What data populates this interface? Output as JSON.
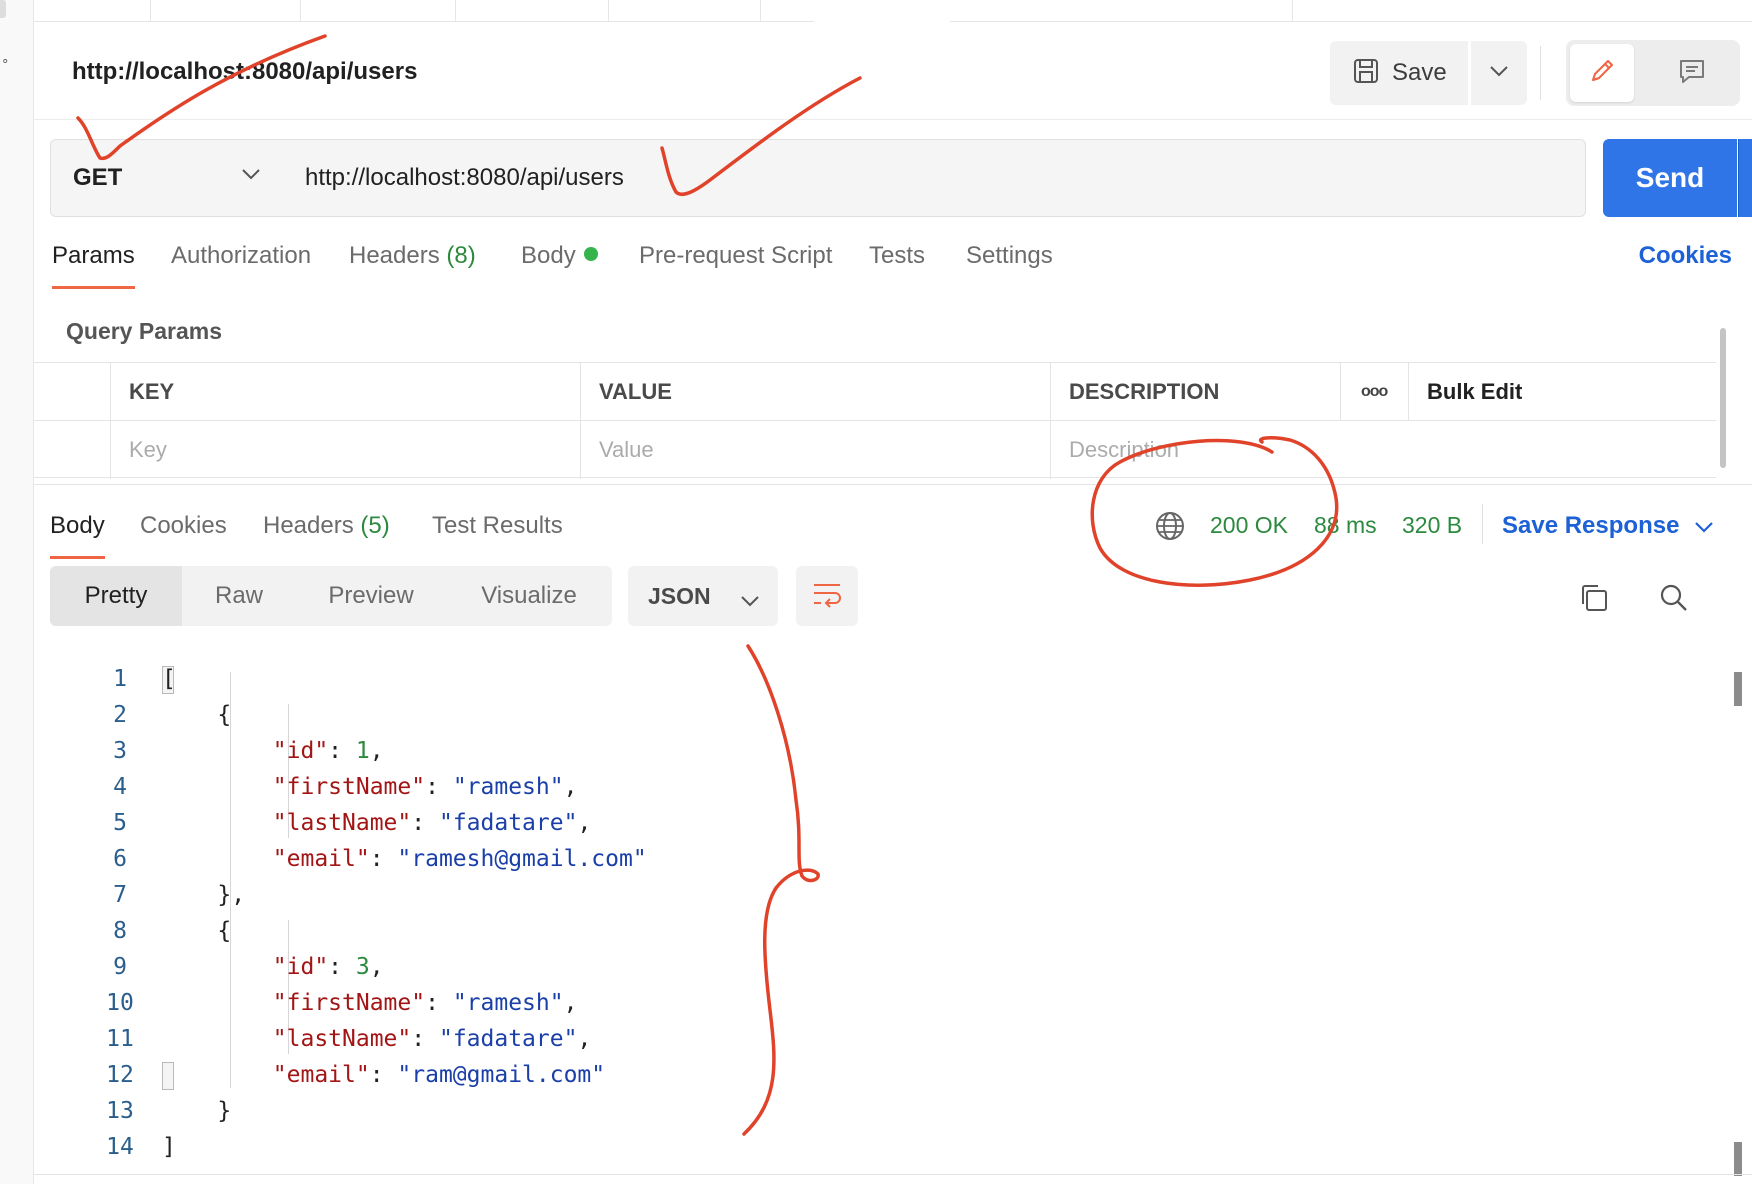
{
  "request": {
    "title": "http://localhost:8080/api/users",
    "save_label": "Save",
    "method": "GET",
    "url": "http://localhost:8080/api/users",
    "send_label": "Send"
  },
  "request_tabs": [
    {
      "label": "Params"
    },
    {
      "label": "Authorization"
    },
    {
      "label": "Headers",
      "count": "(8)"
    },
    {
      "label": "Body"
    },
    {
      "label": "Pre-request Script"
    },
    {
      "label": "Tests"
    },
    {
      "label": "Settings"
    }
  ],
  "cookies_link": "Cookies",
  "query_params": {
    "title": "Query Params",
    "headers": {
      "key": "KEY",
      "value": "VALUE",
      "description": "DESCRIPTION",
      "more": "ooo",
      "bulk_edit": "Bulk Edit"
    },
    "placeholders": {
      "key": "Key",
      "value": "Value",
      "description": "Description"
    }
  },
  "response": {
    "tabs": [
      {
        "label": "Body"
      },
      {
        "label": "Cookies"
      },
      {
        "label": "Headers",
        "count": "(5)"
      },
      {
        "label": "Test Results"
      }
    ],
    "status": "200 OK",
    "time": "88 ms",
    "size": "320 B",
    "save_response": "Save Response",
    "views": [
      "Pretty",
      "Raw",
      "Preview",
      "Visualize"
    ],
    "format": "JSON"
  },
  "code": {
    "line_numbers": [
      "1",
      "2",
      "3",
      "4",
      "5",
      "6",
      "7",
      "8",
      "9",
      "10",
      "11",
      "12",
      "13",
      "14"
    ],
    "lines": [
      {
        "open": "["
      },
      {
        "brace": "{"
      },
      {
        "key": "\"id\"",
        "num": "1",
        "end": ","
      },
      {
        "key": "\"firstName\"",
        "str": "\"ramesh\"",
        "end": ","
      },
      {
        "key": "\"lastName\"",
        "str": "\"fadatare\"",
        "end": ","
      },
      {
        "key": "\"email\"",
        "str": "\"ramesh@gmail.com\"",
        "end": ""
      },
      {
        "brace": "},"
      },
      {
        "brace": "{"
      },
      {
        "key": "\"id\"",
        "num": "3",
        "end": ","
      },
      {
        "key": "\"firstName\"",
        "str": "\"ramesh\"",
        "end": ","
      },
      {
        "key": "\"lastName\"",
        "str": "\"fadatare\"",
        "end": ","
      },
      {
        "key": "\"email\"",
        "str": "\"ram@gmail.com\"",
        "end": ""
      },
      {
        "brace": "}"
      },
      {
        "open": "]"
      }
    ]
  },
  "colors": {
    "accent_blue": "#2f75e8",
    "link_blue": "#1d61d6",
    "status_green": "#2b8a3e",
    "tab_underline": "#f06543",
    "annotation_red": "#e0432a"
  }
}
